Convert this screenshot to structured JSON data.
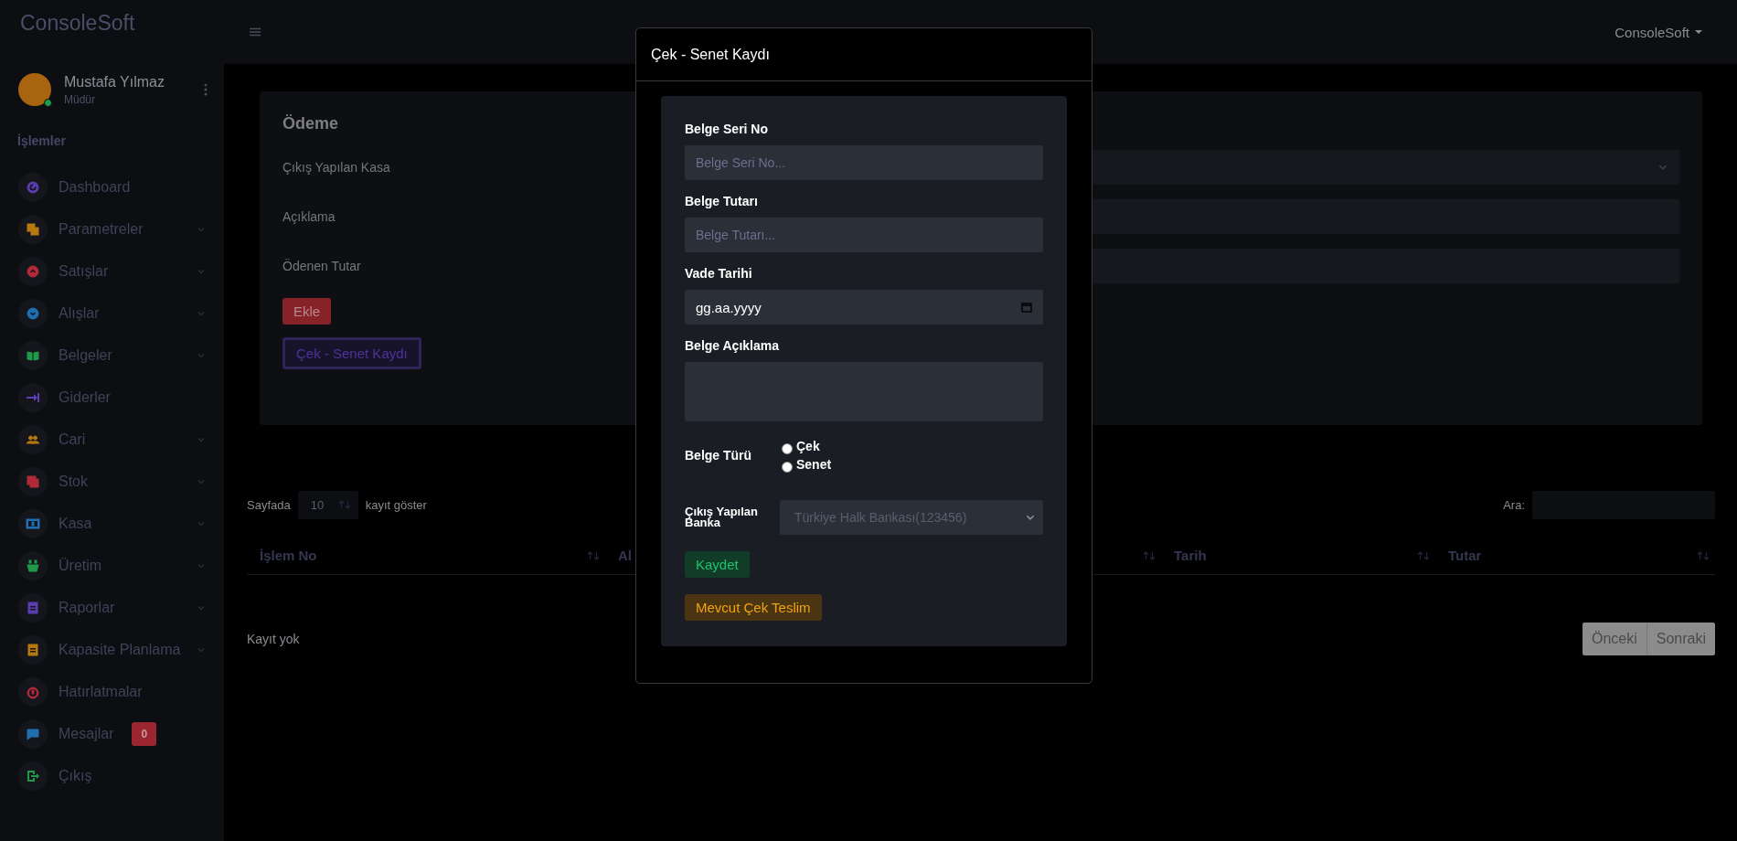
{
  "brand": "ConsoleSoft",
  "header": {
    "user_menu": "ConsoleSoft"
  },
  "user": {
    "name": "Mustafa Yılmaz",
    "role": "Müdür",
    "online": true
  },
  "sidebar": {
    "heading": "İşlemler",
    "items": [
      {
        "label": "Dashboard",
        "expandable": false,
        "color": "#5b3fb0"
      },
      {
        "label": "Parametreler",
        "expandable": true,
        "color": "#b7780f"
      },
      {
        "label": "Satışlar",
        "expandable": true,
        "color": "#b02a37"
      },
      {
        "label": "Alışlar",
        "expandable": true,
        "color": "#1f6fb0"
      },
      {
        "label": "Belgeler",
        "expandable": true,
        "color": "#1e9a48"
      },
      {
        "label": "Giderler",
        "expandable": false,
        "color": "#5b3fb0"
      },
      {
        "label": "Cari",
        "expandable": true,
        "color": "#b7780f"
      },
      {
        "label": "Stok",
        "expandable": true,
        "color": "#b02a37"
      },
      {
        "label": "Kasa",
        "expandable": true,
        "color": "#1f6fb0"
      },
      {
        "label": "Üretim",
        "expandable": true,
        "color": "#1e9a48"
      },
      {
        "label": "Raporlar",
        "expandable": true,
        "color": "#5b3fb0"
      },
      {
        "label": "Kapasite Planlama",
        "expandable": true,
        "color": "#b7780f"
      },
      {
        "label": "Hatırlatmalar",
        "expandable": false,
        "color": "#b02a37"
      },
      {
        "label": "Mesajlar",
        "expandable": false,
        "color": "#1f6fb0",
        "badge": "0"
      },
      {
        "label": "Çıkış",
        "expandable": false,
        "color": "#1e9a48"
      }
    ]
  },
  "payment_form": {
    "title": "Ödeme",
    "fields": [
      {
        "label": "Çıkış Yapılan Kasa",
        "kind": "select"
      },
      {
        "label": "Açıklama",
        "kind": "text"
      },
      {
        "label": "Ödenen Tutar",
        "kind": "text"
      }
    ],
    "buttons": [
      {
        "label": "Ekle",
        "kind": "danger"
      },
      {
        "label": "Çek - Senet Kaydı",
        "kind": "outline"
      }
    ]
  },
  "table": {
    "length_prefix": "Sayfada",
    "length_value": "10",
    "length_suffix": "kayıt göster",
    "search_label": "Ara:",
    "columns": [
      {
        "label": "İşlem No"
      },
      {
        "label": "Al"
      },
      {
        "label": "Tarih"
      },
      {
        "label": "Tutar"
      }
    ],
    "empty": "Kayıt yok",
    "pagination": [
      {
        "label": "Önceki"
      },
      {
        "label": "Sonraki"
      }
    ]
  },
  "modal": {
    "title": "Çek - Senet Kaydı",
    "fields": [
      {
        "label": "Belge Seri No",
        "kind": "text",
        "placeholder": "Belge Seri No..."
      },
      {
        "label": "Belge Tutarı",
        "kind": "text",
        "placeholder": "Belge Tutarı..."
      },
      {
        "label": "Vade Tarihi",
        "kind": "date",
        "value": "gg.aa.yyyy"
      },
      {
        "label": "Belge Açıklama",
        "kind": "textarea"
      }
    ],
    "doc_type": {
      "label": "Belge Türü",
      "options": [
        {
          "label": "Çek",
          "selected": false
        },
        {
          "label": "Senet",
          "selected": false
        }
      ]
    },
    "bank": {
      "label": "Çıkış Yapılan Banka",
      "value": "Türkiye Halk Bankası(123456)"
    },
    "buttons": [
      {
        "label": "Kaydet",
        "kind": "success"
      },
      {
        "label": "Mevcut Çek Teslim",
        "kind": "warning"
      }
    ]
  }
}
